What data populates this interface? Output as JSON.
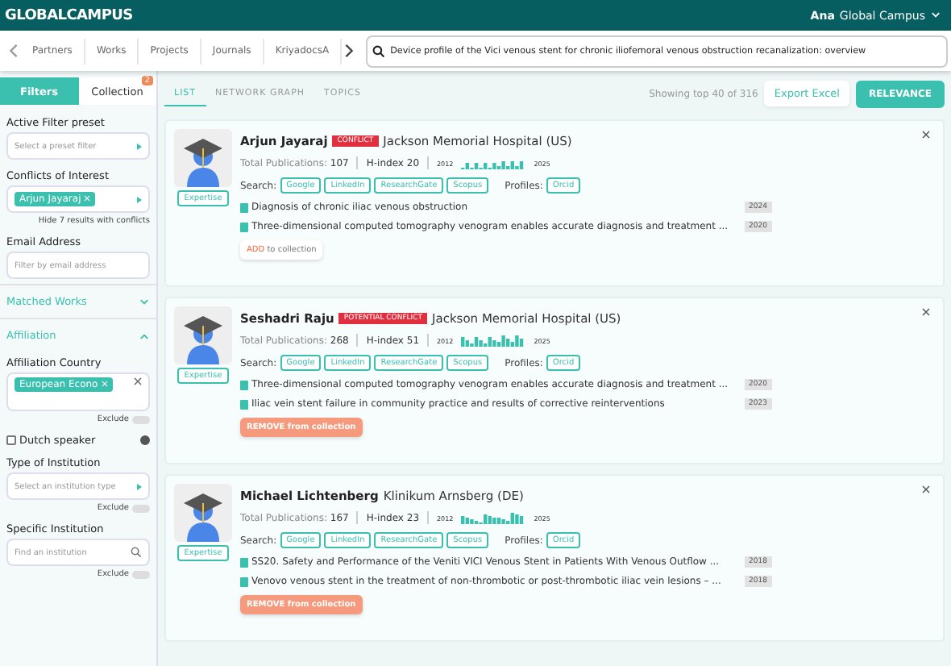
{
  "header": {
    "logo": "GLOBALCAMPUS",
    "user_first": "Ana",
    "user_org": "Global Campus"
  },
  "nav": {
    "tabs": [
      "Partners",
      "Works",
      "Projects",
      "Journals",
      "KriyadocsA"
    ],
    "search_value": "Device profile of the Vici venous stent for chronic iliofemoral venous obstruction recanalization: overview"
  },
  "sidebar": {
    "tabs": [
      {
        "label": "Filters",
        "selected": true
      },
      {
        "label": "Collection",
        "selected": false,
        "badge": "2"
      }
    ],
    "filters": [
      {
        "kind": "select",
        "label": "Active Filter preset",
        "placeholder": "Select a preset filter"
      },
      {
        "kind": "chips",
        "label": "Conflicts of Interest",
        "chips": [
          "Arjun Jayaraj"
        ],
        "note": "Hide 7 results with conflicts"
      },
      {
        "kind": "input",
        "label": "Email Address",
        "placeholder": "Filter by email address"
      },
      {
        "kind": "section",
        "label": "Matched Works",
        "expanded": false
      },
      {
        "kind": "section",
        "label": "Affiliation",
        "expanded": true
      },
      {
        "kind": "country",
        "label": "Affiliation Country",
        "chips": [
          "European Econo"
        ],
        "exclude": "Exclude"
      },
      {
        "kind": "checkbox",
        "label": "Dutch speaker",
        "checked": false
      },
      {
        "kind": "select",
        "label": "Type of Institution",
        "placeholder": "Select an institution type",
        "exclude": "Exclude"
      },
      {
        "kind": "search",
        "label": "Specific Institution",
        "placeholder": "Find an institution",
        "exclude": "Exclude"
      }
    ]
  },
  "views": [
    {
      "label": "LIST",
      "selected": true
    },
    {
      "label": "NETWORK GRAPH",
      "selected": false
    },
    {
      "label": "TOPICS",
      "selected": false
    }
  ],
  "showing": "Showing top 40 of 316",
  "export": "Export Excel",
  "sort": "RELEVANCE",
  "people": [
    {
      "name": "Arjun Jayaraj",
      "conflict": "CONFLICT",
      "affiliation": "Jackson Memorial Hospital (US)",
      "pubs_label": "Total Publications:",
      "pubs": "107",
      "hindex": "H-index 20",
      "from": "2012",
      "to": "2025",
      "expertise": "Expertise",
      "search_label": "Search:",
      "search": [
        "Google",
        "LinkedIn",
        "ResearchGate",
        "Scopus"
      ],
      "profiles_label": "Profiles:",
      "profiles": [
        "Orcid"
      ],
      "works": [
        {
          "title": "Diagnosis of chronic iliac venous obstruction",
          "year": "2024"
        },
        {
          "title": "Three-dimensional computed tomography venogram enables accurate diagnosis and treatment ...",
          "year": "2020"
        }
      ],
      "in_collection": false,
      "action": "ADD",
      "action_rest": "to collection"
    },
    {
      "name": "Seshadri Raju",
      "conflict": "POTENTIAL CONFLICT",
      "affiliation": "Jackson Memorial Hospital (US)",
      "pubs_label": "Total Publications:",
      "pubs": "268",
      "hindex": "H-index 51",
      "from": "2012",
      "to": "2025",
      "expertise": "Expertise",
      "search_label": "Search:",
      "search": [
        "Google",
        "LinkedIn",
        "ResearchGate",
        "Scopus"
      ],
      "profiles_label": "Profiles:",
      "profiles": [
        "Orcid"
      ],
      "works": [
        {
          "title": "Three-dimensional computed tomography venogram enables accurate diagnosis and treatment ...",
          "year": "2020"
        },
        {
          "title": "Iliac vein stent failure in community practice and results of corrective reinterventions",
          "year": "2023"
        }
      ],
      "in_collection": true,
      "action": "REMOVE",
      "action_rest": "from collection"
    },
    {
      "name": "Michael Lichtenberg",
      "affiliation": "Klinikum Arnsberg (DE)",
      "pubs_label": "Total Publications:",
      "pubs": "167",
      "hindex": "H-index 23",
      "from": "2012",
      "to": "2025",
      "expertise": "Expertise",
      "search_label": "Search:",
      "search": [
        "Google",
        "LinkedIn",
        "ResearchGate",
        "Scopus"
      ],
      "profiles_label": "Profiles:",
      "profiles": [
        "Orcid"
      ],
      "works": [
        {
          "title": "SS20. Safety and Performance of the Veniti VICI Venous Stent in Patients With Venous Outflow ...",
          "year": "2018"
        },
        {
          "title": "Venovo venous stent in the treatment of non-thrombotic or post-thrombotic iliac vein lesions – ...",
          "year": "2018"
        }
      ],
      "in_collection": true,
      "action": "REMOVE",
      "action_rest": "from collection"
    }
  ]
}
